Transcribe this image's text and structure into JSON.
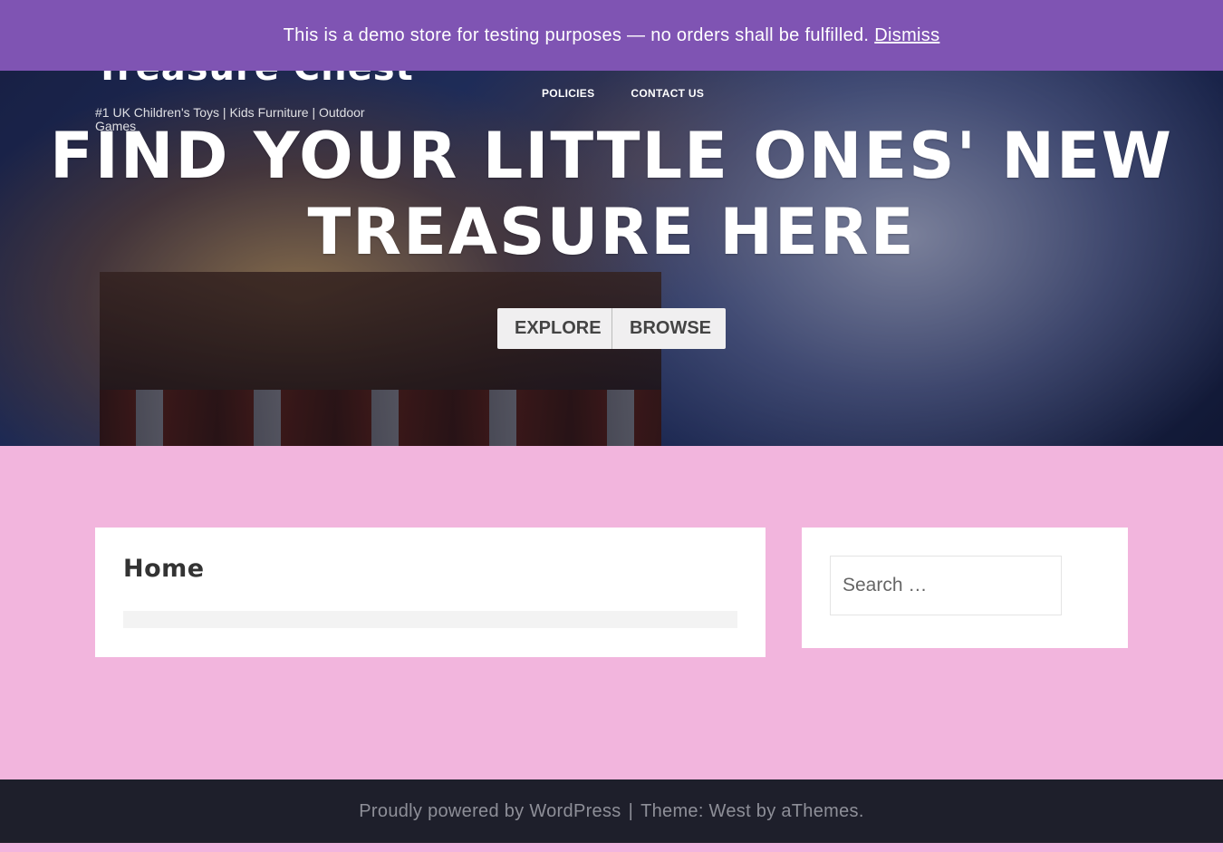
{
  "notice": {
    "text": "This is a demo store for testing purposes — no orders shall be fulfilled.",
    "dismiss_label": "Dismiss"
  },
  "site": {
    "title": "Treasure Chest",
    "tagline": "#1 UK Children's Toys | Kids Furniture | Outdoor Games"
  },
  "nav": {
    "items": [
      {
        "label": "POLICIES"
      },
      {
        "label": "CONTACT US"
      }
    ]
  },
  "hero": {
    "heading": "FIND YOUR LITTLE ONES' NEW TREASURE HERE",
    "buttons": {
      "explore": "EXPLORE",
      "browse": "BROWSE"
    }
  },
  "content": {
    "page_title": "Home"
  },
  "sidebar": {
    "search": {
      "placeholder": "Search …",
      "value": ""
    }
  },
  "footer": {
    "powered_text": "Proudly powered by WordPress",
    "separator": "|",
    "theme_text": "Theme: West by aThemes."
  },
  "colors": {
    "notice_bg": "#7f54b3",
    "page_bg": "#f2b5dd",
    "footer_bg": "#1e1f2b",
    "card_bg": "#ffffff"
  }
}
